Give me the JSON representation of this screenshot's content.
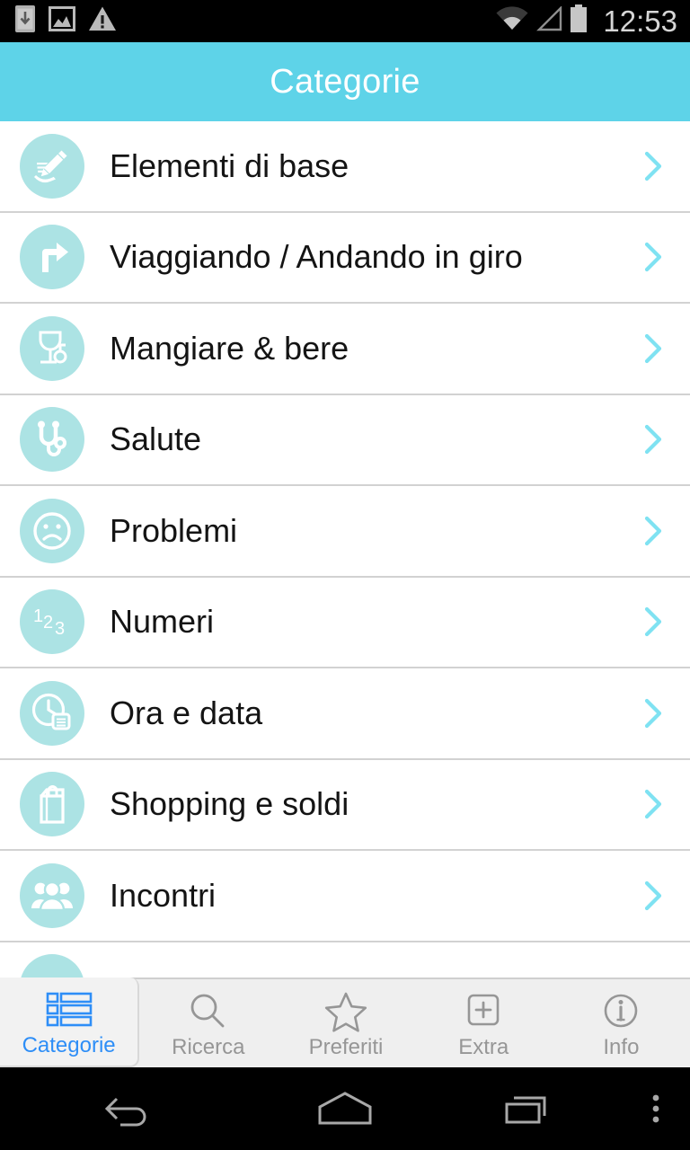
{
  "statusbar": {
    "time": "12:53",
    "icons": [
      {
        "name": "download-to-phone-icon"
      },
      {
        "name": "image-icon"
      },
      {
        "name": "warning-triangle-icon"
      }
    ],
    "right_icons": [
      {
        "name": "wifi-icon"
      },
      {
        "name": "cellular-signal-icon"
      },
      {
        "name": "battery-full-icon"
      }
    ]
  },
  "actionbar": {
    "title": "Categorie",
    "background_color": "#5ed3e8",
    "text_color": "#ffffff"
  },
  "list": {
    "accent_color": "#ace3e4",
    "chevron_color": "#7fe2f2",
    "divider_color": "#d2d2d2",
    "items": [
      {
        "label": "Elementi di base",
        "icon": "hand-writing-pencil-icon"
      },
      {
        "label": "Viaggiando  /  Andando in giro",
        "icon": "turn-right-arrow-icon"
      },
      {
        "label": "Mangiare & bere",
        "icon": "wine-glass-icon"
      },
      {
        "label": "Salute",
        "icon": "stethoscope-icon"
      },
      {
        "label": "Problemi",
        "icon": "sad-face-icon"
      },
      {
        "label": "Numeri",
        "icon": "numbers-123-icon"
      },
      {
        "label": "Ora e data",
        "icon": "clock-calendar-icon"
      },
      {
        "label": "Shopping e soldi",
        "icon": "shopping-bag-icon"
      },
      {
        "label": "Incontri",
        "icon": "people-group-icon"
      }
    ]
  },
  "tabbar": {
    "active_color": "#2e8ef7",
    "inactive_color": "#969696",
    "tabs": [
      {
        "label": "Categorie",
        "icon": "list-grid-icon",
        "active": true
      },
      {
        "label": "Ricerca",
        "icon": "search-icon",
        "active": false
      },
      {
        "label": "Preferiti",
        "icon": "star-icon",
        "active": false
      },
      {
        "label": "Extra",
        "icon": "plus-square-icon",
        "active": false
      },
      {
        "label": "Info",
        "icon": "info-circle-icon",
        "active": false
      }
    ]
  },
  "navbar": {
    "buttons": [
      {
        "name": "back-button",
        "icon": "back-arrow-icon"
      },
      {
        "name": "home-button",
        "icon": "home-icon"
      },
      {
        "name": "recents-button",
        "icon": "recents-icon"
      },
      {
        "name": "overflow-menu-button",
        "icon": "three-dots-icon"
      }
    ]
  }
}
